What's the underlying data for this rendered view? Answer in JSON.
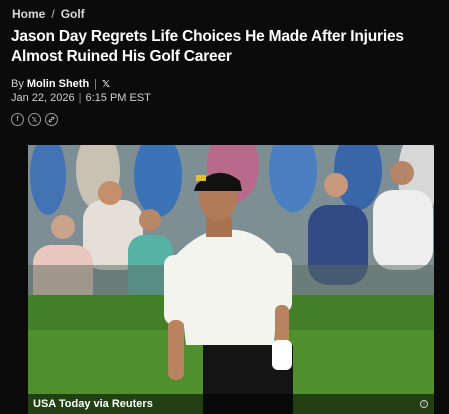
{
  "breadcrumb": {
    "home": "Home",
    "separator": "/",
    "section": "Golf"
  },
  "article": {
    "title": "Jason Day Regrets Life Choices He Made After Injuries Almost Ruined His Golf Career",
    "by_prefix": "By",
    "author": "Molin Sheth",
    "author_social_icon": "x-icon",
    "date": "Jan 22, 2026",
    "time": "6:15 PM EST"
  },
  "share": {
    "icons": [
      "facebook-icon",
      "x-icon",
      "link-icon"
    ]
  },
  "photo": {
    "credit": "USA Today via Reuters",
    "info_icon": "info-icon"
  },
  "colors": {
    "background": "#0b0b0b",
    "text": "#ffffff",
    "muted": "#cfcfcf"
  }
}
